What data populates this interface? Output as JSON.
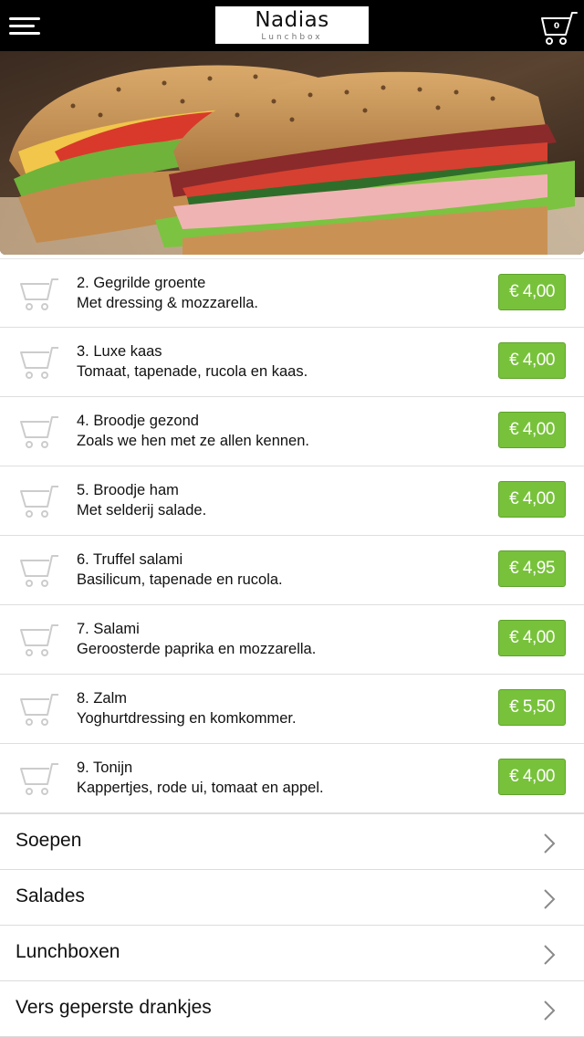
{
  "header": {
    "menu_icon": "hamburger-menu-icon",
    "logo_title": "Nadias",
    "logo_subtitle": "Lunchbox",
    "cart_icon": "shopping-cart-icon",
    "cart_count": "0"
  },
  "hero": {
    "image": "sandwich-photo"
  },
  "products": [
    {
      "name": "2. Gegrilde groente",
      "description": "Met dressing & mozzarella.",
      "price": "€ 4,00"
    },
    {
      "name": "3. Luxe kaas",
      "description": "Tomaat, tapenade, rucola en kaas.",
      "price": "€ 4,00"
    },
    {
      "name": "4. Broodje gezond",
      "description": "Zoals we hen met ze allen kennen.",
      "price": "€ 4,00"
    },
    {
      "name": "5. Broodje ham",
      "description": "Met selderij salade.",
      "price": "€ 4,00"
    },
    {
      "name": "6. Truffel salami",
      "description": "Basilicum, tapenade en rucola.",
      "price": "€ 4,95"
    },
    {
      "name": "7. Salami",
      "description": "Geroosterde paprika en mozzarella.",
      "price": "€ 4,00"
    },
    {
      "name": "8. Zalm",
      "description": "Yoghurtdressing en komkommer.",
      "price": "€ 5,50"
    },
    {
      "name": "9. Tonijn",
      "description": "Kappertjes, rode ui, tomaat en appel.",
      "price": "€ 4,00"
    }
  ],
  "categories": [
    {
      "label": "Soepen"
    },
    {
      "label": "Salades"
    },
    {
      "label": "Lunchboxen"
    },
    {
      "label": "Vers geperste drankjes"
    }
  ],
  "colors": {
    "header_bg": "#000000",
    "price_button": "#77c23a",
    "divider": "#dedede"
  }
}
